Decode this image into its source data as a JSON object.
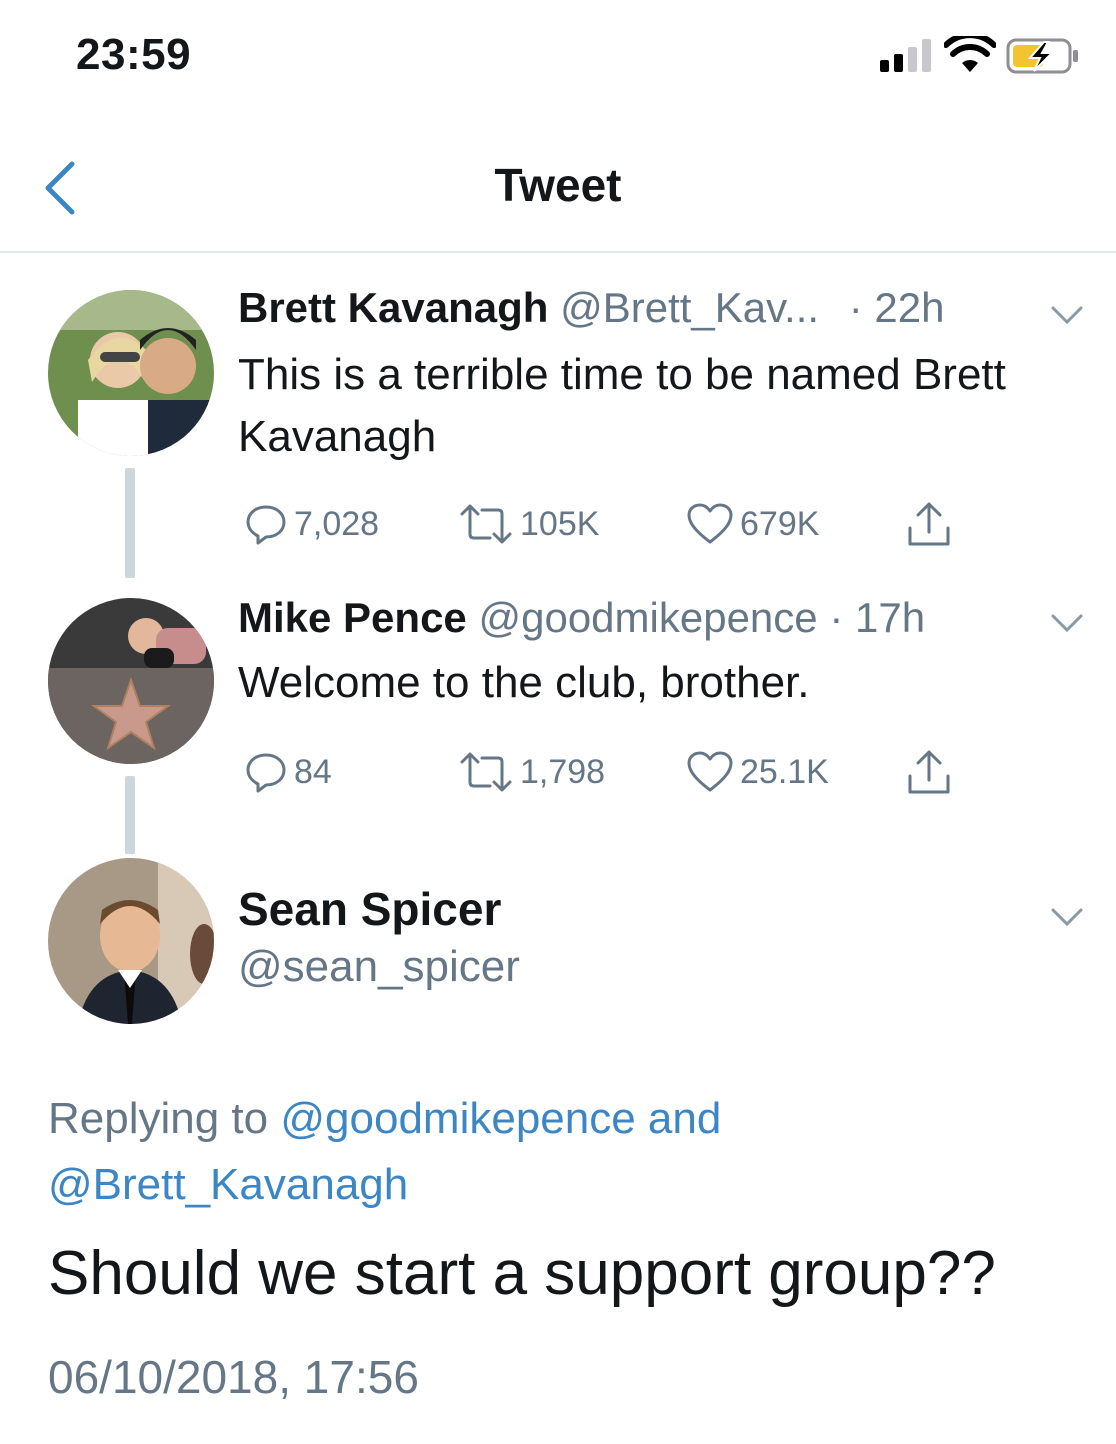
{
  "status_bar": {
    "time": "23:59"
  },
  "nav": {
    "title": "Tweet"
  },
  "thread": [
    {
      "name": "Brett Kavanagh",
      "handle": "@Brett_Kav...",
      "time": "· 22h",
      "text": "This is a terrible time to be named Brett Kavanagh",
      "replies": "7,028",
      "retweets": "105K",
      "likes": "679K"
    },
    {
      "name": "Mike Pence",
      "handle": "@goodmikepence",
      "time": "· 17h",
      "text": "Welcome to the club, brother.",
      "replies": "84",
      "retweets": "1,798",
      "likes": "25.1K"
    }
  ],
  "main_tweet": {
    "name": "Sean Spicer",
    "handle": "@sean_spicer",
    "replying_prefix": "Replying to",
    "reply_mention_1": "@goodmikepence and",
    "reply_mention_2": "@Brett_Kavanagh",
    "text": "Should we start a support group??",
    "timestamp": "06/10/2018, 17:56"
  },
  "colors": {
    "accent": "#3c86c6",
    "muted": "#657786",
    "text": "#14171a",
    "divider": "#e1e8ed"
  }
}
